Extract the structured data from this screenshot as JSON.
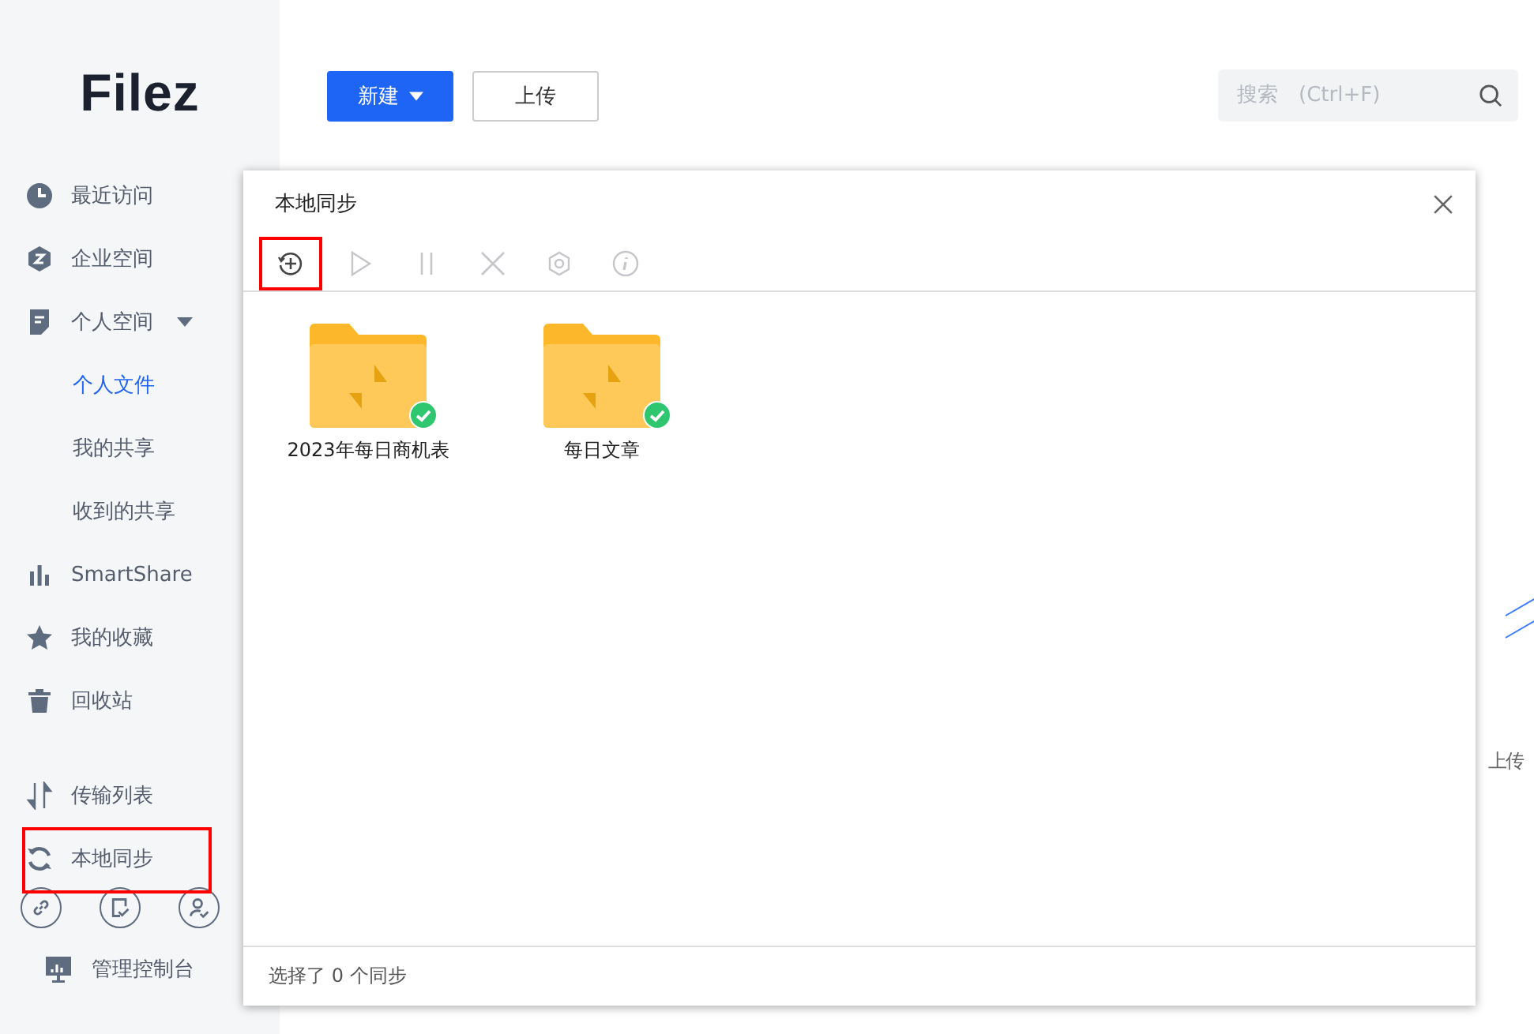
{
  "sidebar": {
    "logo": "Filez",
    "items": [
      {
        "label": "最近访问",
        "selected": false,
        "highlighted": false
      },
      {
        "label": "企业空间",
        "selected": false,
        "highlighted": false
      },
      {
        "label": "个人空间",
        "selected": false,
        "highlighted": false,
        "expanded": true,
        "children": [
          {
            "label": "个人文件",
            "selected": true
          },
          {
            "label": "我的共享",
            "selected": false
          },
          {
            "label": "收到的共享",
            "selected": false
          }
        ]
      },
      {
        "label": "SmartShare",
        "selected": false,
        "highlighted": false
      },
      {
        "label": "我的收藏",
        "selected": false,
        "highlighted": false
      },
      {
        "label": "回收站",
        "selected": false,
        "highlighted": false
      }
    ],
    "bottom_items": [
      {
        "label": "传输列表",
        "selected": false,
        "highlighted": false
      },
      {
        "label": "本地同步",
        "selected": false,
        "highlighted": true
      }
    ],
    "admin": "管理控制台"
  },
  "toolbar": {
    "new_button": "新建",
    "upload_button": "上传",
    "search": {
      "placeholder": "搜索　(Ctrl+F)"
    }
  },
  "side_text": "上传",
  "dialog": {
    "title": "本地同步",
    "tools": [
      {
        "disabled": false,
        "highlighted": true
      },
      {
        "disabled": true
      },
      {
        "disabled": true
      },
      {
        "disabled": true
      },
      {
        "disabled": true
      },
      {
        "disabled": true
      }
    ],
    "folders": [
      {
        "name": "2023年每日商机表",
        "synced": true
      },
      {
        "name": "每日文章",
        "synced": true
      }
    ],
    "status": "选择了 0 个同步"
  }
}
